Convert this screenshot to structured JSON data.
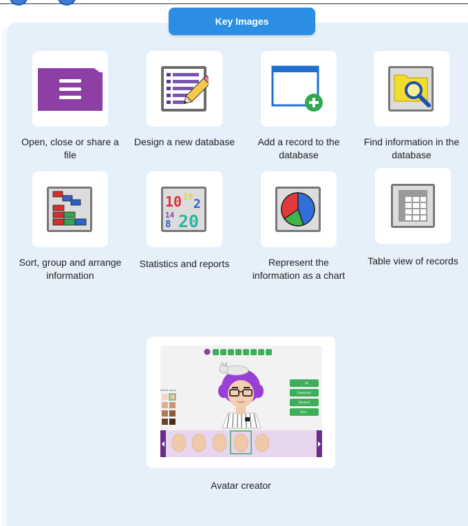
{
  "header": {
    "title": "Key Images"
  },
  "items": [
    {
      "label": "Open, close or share a file",
      "icon": "folder-open-icon"
    },
    {
      "label": "Design a new database",
      "icon": "design-database-icon"
    },
    {
      "label": "Add a record to the database",
      "icon": "add-record-icon"
    },
    {
      "label": "Find information in the database",
      "icon": "find-folder-icon"
    },
    {
      "label": "Sort, group and arrange information",
      "icon": "sort-group-icon"
    },
    {
      "label": "Statistics and reports",
      "icon": "statistics-icon"
    },
    {
      "label": "Represent the information as a chart",
      "icon": "pie-chart-icon"
    },
    {
      "label": "Table view of records",
      "icon": "table-icon"
    }
  ],
  "stats_icon_numbers": [
    "10",
    "19",
    "2",
    "14",
    "8",
    "20"
  ],
  "avatar": {
    "label": "Avatar creator",
    "select_colour": "Select colour",
    "buttons": [
      "Ok",
      "Download",
      "Random",
      "Print"
    ]
  },
  "colors": {
    "accent": "#2b8de3",
    "panel": "#e5f0fa",
    "purple": "#8e3fa6",
    "chart_red": "#e23a3a",
    "chart_green": "#3fb54a",
    "chart_blue": "#2f6fd8",
    "avatar_strip": "#e8d5ee",
    "avatar_green": "#3fae5a"
  }
}
